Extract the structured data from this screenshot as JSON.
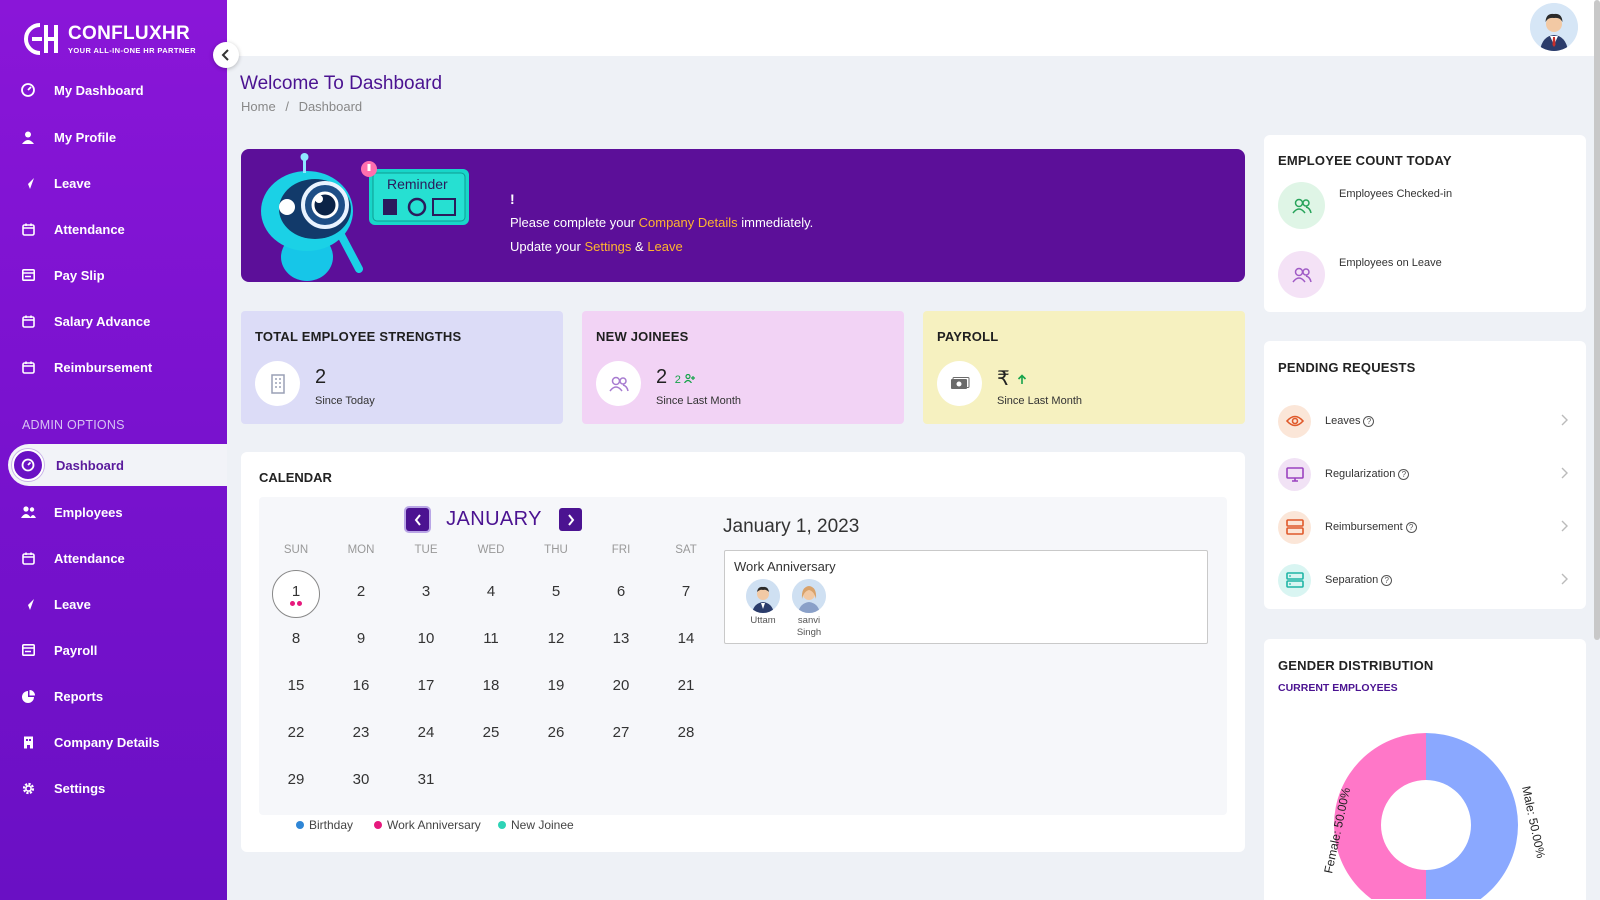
{
  "brand": {
    "name": "CONFLUXHR",
    "tagline": "YOUR ALL-IN-ONE HR PARTNER"
  },
  "sidebar": {
    "items": [
      {
        "label": "My Dashboard",
        "icon": "dashboard-icon"
      },
      {
        "label": "My Profile",
        "icon": "user-icon"
      },
      {
        "label": "Leave",
        "icon": "plane-icon"
      },
      {
        "label": "Attendance",
        "icon": "calendar-icon"
      },
      {
        "label": "Pay Slip",
        "icon": "payslip-icon"
      },
      {
        "label": "Salary Advance",
        "icon": "calendar-icon"
      },
      {
        "label": "Reimbursement",
        "icon": "calendar-icon"
      }
    ],
    "admin_section": "ADMIN OPTIONS",
    "admin_items": [
      {
        "label": "Dashboard",
        "icon": "dashboard-icon",
        "active": true
      },
      {
        "label": "Employees",
        "icon": "users-icon"
      },
      {
        "label": "Attendance",
        "icon": "calendar-icon"
      },
      {
        "label": "Leave",
        "icon": "plane-icon"
      },
      {
        "label": "Payroll",
        "icon": "payslip-icon"
      },
      {
        "label": "Reports",
        "icon": "pie-icon"
      },
      {
        "label": "Company Details",
        "icon": "building-icon"
      },
      {
        "label": "Settings",
        "icon": "gear-icon"
      }
    ]
  },
  "header": {
    "title": "Welcome To Dashboard",
    "breadcrumb": [
      "Home",
      "/",
      "Dashboard"
    ]
  },
  "reminder": {
    "badge_label": "Reminder",
    "bang": "!",
    "line1_pre": "Please complete your ",
    "line1_link": "Company Details",
    "line1_post": " immediately.",
    "line2_pre": "Update your ",
    "line2_link1": "Settings",
    "line2_mid": " & ",
    "line2_link2": "Leave"
  },
  "stats": [
    {
      "title": "TOTAL EMPLOYEE STRENGTHS",
      "value": "2",
      "sub": "Since Today",
      "bg": "#dcdcf7",
      "icon": "building-icon"
    },
    {
      "title": "NEW JOINEES",
      "value": "2",
      "delta": "2",
      "sub": "Since Last Month",
      "bg": "#f2d3f5",
      "icon": "users-icon"
    },
    {
      "title": "PAYROLL",
      "value": "₹",
      "sub": "Since Last Month",
      "bg": "#f6f1c0",
      "icon": "cash-icon"
    }
  ],
  "calendar": {
    "title": "CALENDAR",
    "month": "JANUARY",
    "weekdays": [
      "SUN",
      "MON",
      "TUE",
      "WED",
      "THU",
      "FRI",
      "SAT"
    ],
    "weeks": [
      [
        "1",
        "2",
        "3",
        "4",
        "5",
        "6",
        "7"
      ],
      [
        "8",
        "9",
        "10",
        "11",
        "12",
        "13",
        "14"
      ],
      [
        "15",
        "16",
        "17",
        "18",
        "19",
        "20",
        "21"
      ],
      [
        "22",
        "23",
        "24",
        "25",
        "26",
        "27",
        "28"
      ],
      [
        "29",
        "30",
        "31",
        "",
        "",
        "",
        ""
      ]
    ],
    "selected_date": "January 1, 2023",
    "event": {
      "title": "Work Anniversary",
      "people": [
        {
          "name": "Uttam"
        },
        {
          "name1": "sanvi",
          "name2": "Singh"
        }
      ]
    },
    "legend": [
      {
        "label": "Birthday",
        "color": "#2f86d6"
      },
      {
        "label": "Work Anniversary",
        "color": "#e6197d"
      },
      {
        "label": "New Joinee",
        "color": "#2ed3b6"
      }
    ]
  },
  "employee_count": {
    "title": "EMPLOYEE COUNT TODAY",
    "items": [
      {
        "label": "Employees Checked-in"
      },
      {
        "label": "Employees on Leave"
      }
    ]
  },
  "pending": {
    "title": "PENDING REQUESTS",
    "items": [
      {
        "label": "Leaves",
        "icon": "eye-icon"
      },
      {
        "label": "Regularization",
        "icon": "monitor-icon"
      },
      {
        "label": "Reimbursement",
        "icon": "layers-icon"
      },
      {
        "label": "Separation",
        "icon": "server-icon"
      }
    ]
  },
  "gender": {
    "title": "GENDER DISTRIBUTION",
    "subtitle": "CURRENT EMPLOYEES",
    "female_label": "Female: 50.00%",
    "male_label": "Male: 50.00%",
    "female_color": "#ff77c8",
    "male_color": "#8aa8ff"
  }
}
